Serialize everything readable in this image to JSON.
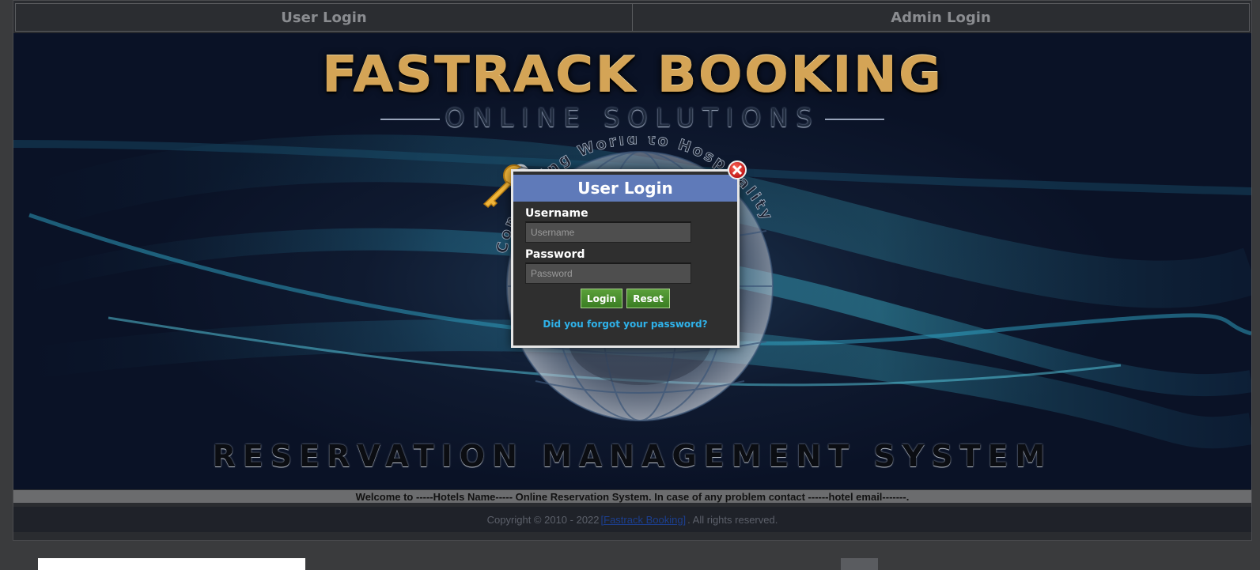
{
  "tabs": [
    {
      "label": "User Login"
    },
    {
      "label": "Admin Login"
    }
  ],
  "brand": {
    "title": "FASTRACK BOOKING",
    "subtitle": "ONLINE SOLUTIONS",
    "tagline": "Connecting World to Hospitality",
    "bottom": "RESERVATION MANAGEMENT SYSTEM"
  },
  "dialog": {
    "title": "User Login",
    "username_label": "Username",
    "username_placeholder": "Username",
    "username_value": "",
    "password_label": "Password",
    "password_placeholder": "Password",
    "password_value": "",
    "login_label": "Login",
    "reset_label": "Reset",
    "forgot_label": "Did you forgot your password?"
  },
  "footer": {
    "welcome": "Welcome to -----Hotels Name----- Online Reservation System. In case of any problem contact ------hotel email-------.",
    "copyright_prefix": "Copyright © 2010 - 2022",
    "copyright_link": "[Fastrack Booking]",
    "copyright_suffix": ". All rights reserved."
  },
  "colors": {
    "header_blue": "#5f7ab9",
    "button_green": "#4a8f2e",
    "link_blue": "#2fb2ea",
    "brand_gold": "#d4a456"
  }
}
